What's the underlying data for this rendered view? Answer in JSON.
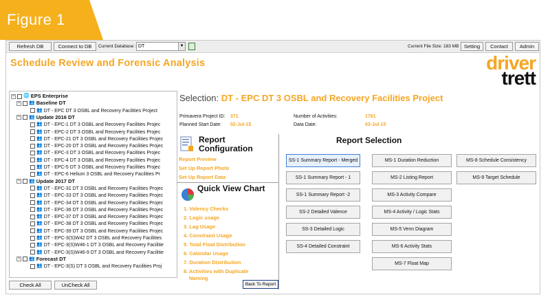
{
  "figure_label": "Figure 1",
  "toolbar": {
    "refresh_db": "Refresh DB",
    "connect_db": "Connect to DB",
    "current_db_label": "Current Database :",
    "current_db_value": "DT",
    "file_size": "Current File Size: 183 MB",
    "setting": "Setting",
    "contact": "Contact",
    "admin": "Admin"
  },
  "app_title": "Schedule Review and Forensic Analysis",
  "logo": {
    "line1": "driver",
    "line2": "trett"
  },
  "tree": {
    "root": "EPS Enterprise",
    "groups": [
      {
        "name": "Baseline DT",
        "items": [
          "DT - EPC DT 3 OSBL and Recovery Facilities Project"
        ]
      },
      {
        "name": "Update 2016 DT",
        "items": [
          "DT - EPC-1 DT 3 OSBL and Recovery Facilities Projec",
          "DT - EPC-2 DT 3 OSBL and Recovery Facilities Projec",
          "DT - EPC-21 DT 3 OSBL and Recovery Facilities Projec",
          "DT - EPC-20 DT 3 OSBL and Recovery Facilities Projec",
          "DT - EPC-3 DT 3 OSBL and Recovery Facilities Projec",
          "DT - EPC-4 DT 3 OSBL and Recovery Facilities Projec",
          "DT - EPC-5 DT 3 OSBL and Recovery Facilities Projec",
          "DT - EPC-6 Helium 3 OSBL and Recovery Facilities Pr"
        ]
      },
      {
        "name": "Update 2017 DT",
        "items": [
          "DT - EPC-31 DT 3 OSBL and Recovery Facilities Projec",
          "DT - EPC-33 DT 3 OSBL and Recovery Facilities Projec",
          "DT - EPC-34 DT 3 OSBL and Recovery Facilities Projec",
          "DT - EPC-36 DT 3 OSBL and Recovery Facilities Projec",
          "DT - EPC-37 DT 3 OSBL and Recovery Facilities Projec",
          "DT - EPC-38 DT 3 OSBL and Recovery Facilities Projec",
          "DT - EPC-39 DT 3 OSBL and Recovery Facilities Projec",
          "DT - EPC-3(S)W42 DT 3 OSBL and Recovery Facilities",
          "DT - EPC-3(S)W46-1 DT 3 OSBL and Recovery Facilitie",
          "DT - EPC-3(S)W46-9 DT 3 OSBL and Recovery Facilitie"
        ]
      },
      {
        "name": "Forecast DT",
        "items": [
          "DT - EPC-3(S) DT 3 OSBL and Recovery Facilities Proj"
        ]
      }
    ]
  },
  "check_all": "Check All",
  "uncheck_all": "UnCheck All",
  "selection": {
    "label": "Selection:",
    "project": "DT - EPC DT 3 OSBL and Recovery Facilities Project",
    "p6_id_label": "Primavera Project ID:",
    "p6_id": "371",
    "planned_start_label": "Planned Start Date:",
    "planned_start": "02-Jul-15",
    "num_activities_label": "Number of Activities:",
    "num_activities": "1761",
    "data_date_label": "Data Date:",
    "data_date": "03-Jul-15"
  },
  "report_config": {
    "title_line1": "Report",
    "title_line2": "Configuration",
    "links": [
      "Report Preview",
      "Set Up Report Photo",
      "Set Up Report Data"
    ]
  },
  "quick_view": {
    "title": "Quick View Chart",
    "items": [
      "1. Valency Checks",
      "2. Logic usage",
      "3. Lag Usage",
      "4. Constraint Usage",
      "5. Total Float Distribution",
      "6. Calendar Usage",
      "7. Duration Distribution",
      "8. Activities with Duplicate",
      "Naming"
    ],
    "back_button": "Back To Report"
  },
  "report_selection": {
    "title": "Report Selection",
    "col1": [
      "SS-1 Summary Report - Merged",
      "SS-1 Summary Report - 1",
      "SS-1 Summary Report -2",
      "SS-2 Detailed Valence",
      "SS-3 Detailed Logic",
      "SS-4 Detailed Constraint"
    ],
    "col2": [
      "MS-1 Duration Reduction",
      "MS-2 Listing Report",
      "MS-3 Activity Compare",
      "MS-4 Activity / Logic Stats",
      "MS-5 Venn Diagram",
      "MS-6 Activity Stats",
      "MS-7 Float Map"
    ],
    "col3": [
      "MS-8 Schedule Consistency",
      "MS-9 Target Schedule"
    ]
  },
  "colors": {
    "accent": "#f5a623",
    "figure_tab": "#f6b01c",
    "active_border": "#3f7ed6"
  }
}
